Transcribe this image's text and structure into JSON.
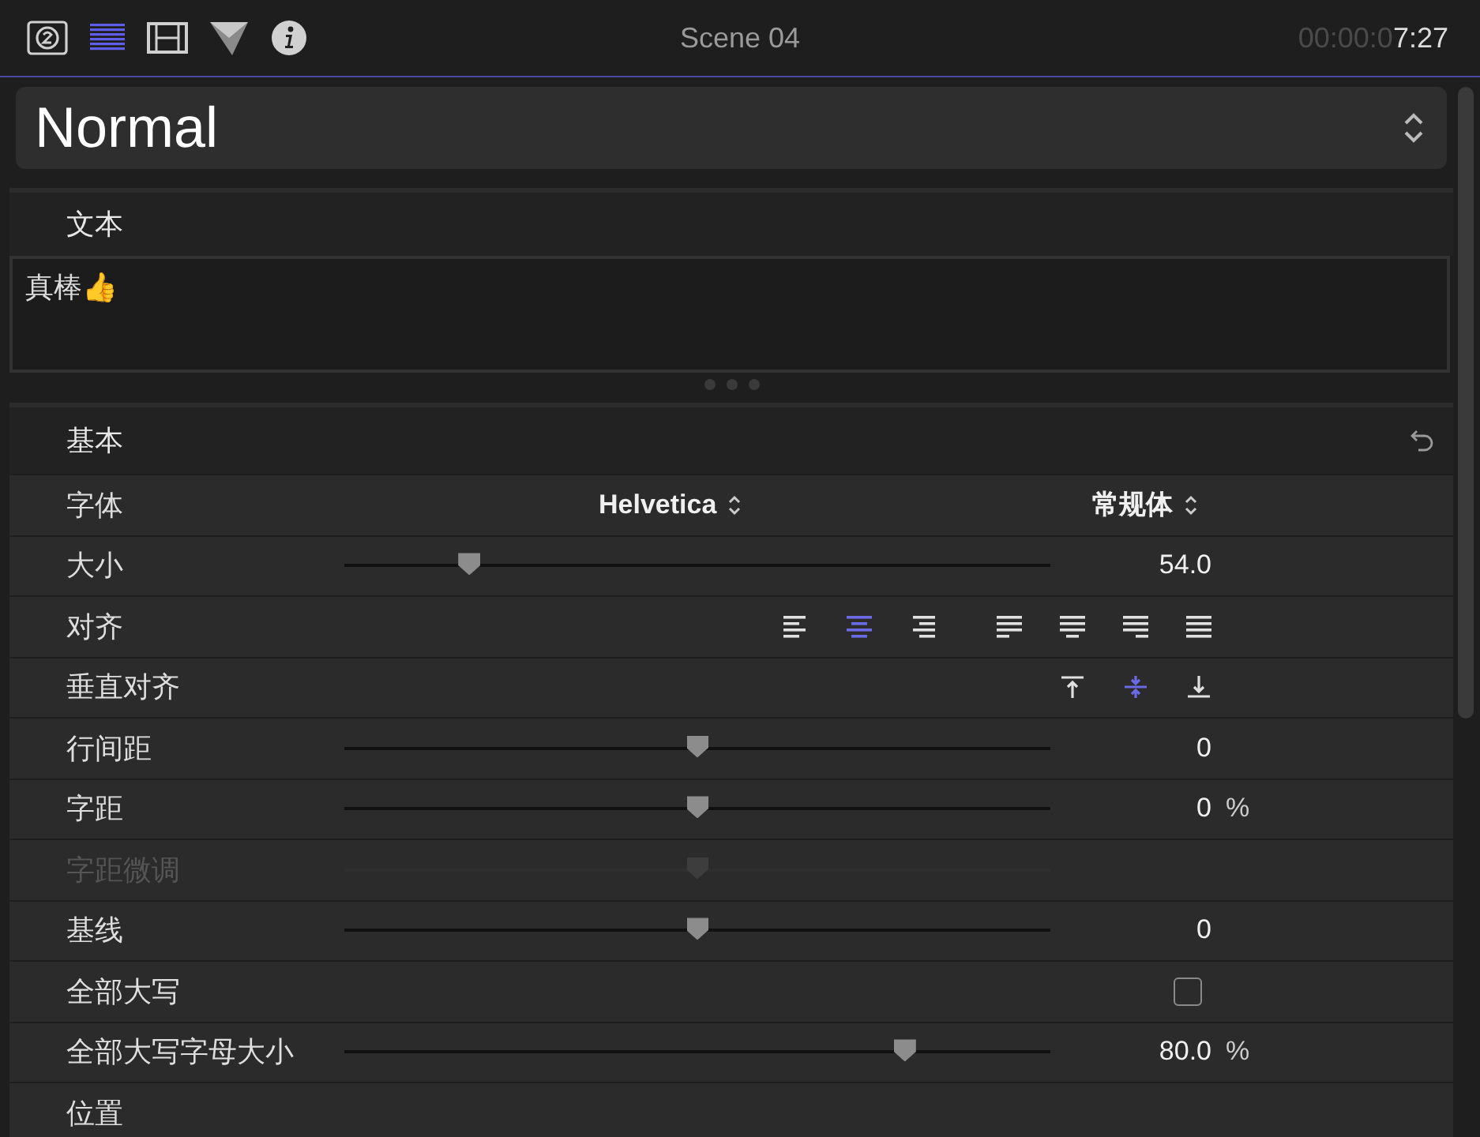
{
  "toolbar": {
    "icons": [
      {
        "kind": "badge",
        "selected": false
      },
      {
        "kind": "lines",
        "selected": true
      },
      {
        "kind": "film",
        "selected": false
      },
      {
        "kind": "triangle",
        "selected": false
      },
      {
        "kind": "info",
        "selected": false
      }
    ],
    "title": "Scene 04",
    "timecode_dim": "00:00:0",
    "timecode": "7:27"
  },
  "preset": {
    "value": "Normal"
  },
  "text_section": {
    "title": "文本",
    "value": "真棒👍"
  },
  "basic_section": {
    "title": "基本",
    "rows": [
      {
        "kind": "popup",
        "label": "字体",
        "disabled": false,
        "font": "Helvetica",
        "style": "常规体"
      },
      {
        "kind": "slider",
        "label": "大小",
        "disabled": false,
        "level": 0.177,
        "value": "54.0"
      },
      {
        "kind": "align",
        "label": "对齐",
        "disabled": false,
        "icons": [
          {
            "kind": "left",
            "selected": false
          },
          {
            "kind": "center",
            "selected": true
          },
          {
            "kind": "right",
            "selected": false
          },
          {
            "kind": "just-left",
            "selected": false
          },
          {
            "kind": "just-center",
            "selected": false
          },
          {
            "kind": "just-right",
            "selected": false
          },
          {
            "kind": "just-all",
            "selected": false
          }
        ]
      },
      {
        "kind": "align",
        "label": "垂直对齐",
        "disabled": false,
        "icons": [
          {
            "kind": "top",
            "selected": false
          },
          {
            "kind": "middle",
            "selected": true
          },
          {
            "kind": "bottom",
            "selected": false
          }
        ]
      },
      {
        "kind": "slider",
        "label": "行间距",
        "disabled": false,
        "level": 0.5,
        "value": "0"
      },
      {
        "kind": "slider",
        "label": "字距",
        "disabled": false,
        "level": 0.5,
        "value": "0",
        "unit": "%"
      },
      {
        "kind": "slider",
        "label": "字距微调",
        "disabled": true,
        "level": 0.5
      },
      {
        "kind": "slider",
        "label": "基线",
        "disabled": false,
        "level": 0.5,
        "value": "0"
      },
      {
        "kind": "checkbox",
        "label": "全部大写",
        "disabled": false,
        "checked": false
      },
      {
        "kind": "slider",
        "label": "全部大写字母大小",
        "disabled": false,
        "level": 0.794,
        "value": "80.0",
        "unit": "%"
      },
      {
        "kind": "heading",
        "label": "位置",
        "disabled": false
      }
    ]
  }
}
